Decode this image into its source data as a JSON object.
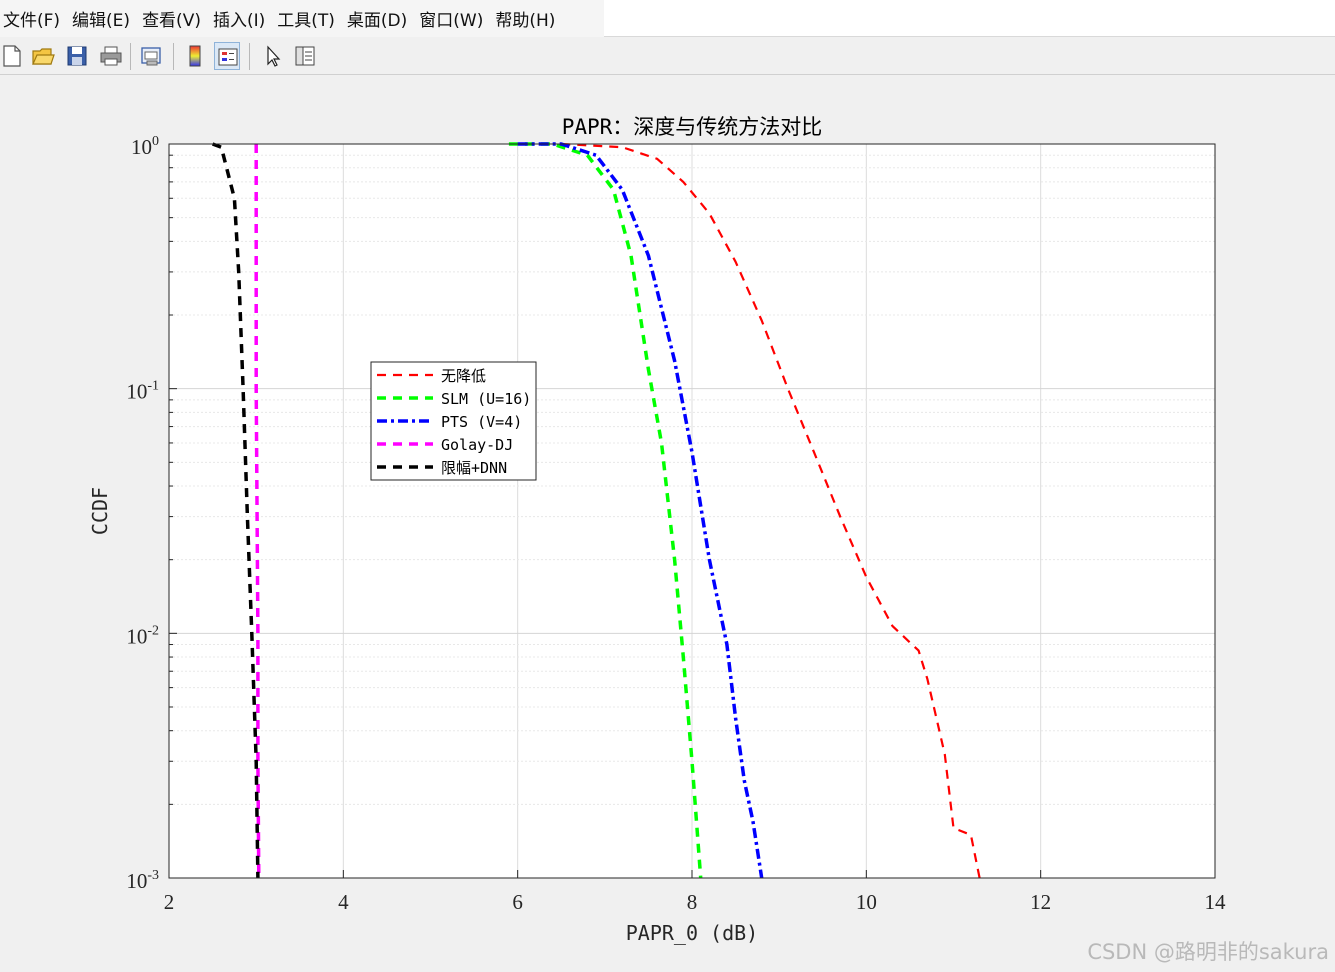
{
  "menu": [
    "文件(F)",
    "编辑(E)",
    "查看(V)",
    "插入(I)",
    "工具(T)",
    "桌面(D)",
    "窗口(W)",
    "帮助(H)"
  ],
  "toolbar": {
    "icons": [
      "new-file-icon",
      "open-folder-icon",
      "save-icon",
      "print-icon",
      "print-preview-icon",
      "colorbar-icon",
      "legend-icon",
      "pointer-icon",
      "property-editor-icon"
    ]
  },
  "watermark": "CSDN @路明非的sakura",
  "chart_data": {
    "type": "line",
    "title": "PAPR：深度与传统方法对比",
    "xlabel": "PAPR_0 (dB)",
    "ylabel": "CCDF",
    "xlim": [
      2,
      14
    ],
    "ylim": [
      0.001,
      1
    ],
    "yscale": "log",
    "xticks": [
      "2",
      "4",
      "6",
      "8",
      "10",
      "12",
      "14"
    ],
    "yticks": [
      {
        "base": "10",
        "exp": "0"
      },
      {
        "base": "10",
        "exp": "-1"
      },
      {
        "base": "10",
        "exp": "-2"
      },
      {
        "base": "10",
        "exp": "-3"
      }
    ],
    "grid": true,
    "legend_position": "inside-left",
    "series": [
      {
        "name": "无降低",
        "color": "#ff0000",
        "style": "dashed",
        "x": [
          6.5,
          7.2,
          7.6,
          7.9,
          8.2,
          8.5,
          8.8,
          9.1,
          9.4,
          9.7,
          10.0,
          10.3,
          10.6,
          10.7,
          10.9,
          11.0,
          11.2,
          11.3
        ],
        "y": [
          1.0,
          0.97,
          0.87,
          0.7,
          0.52,
          0.33,
          0.19,
          0.1,
          0.055,
          0.03,
          0.017,
          0.0107,
          0.0085,
          0.0065,
          0.0032,
          0.0016,
          0.0015,
          0.001
        ]
      },
      {
        "name": "SLM (U=16)",
        "color": "#00ff00",
        "style": "dashed",
        "x": [
          5.9,
          6.4,
          6.8,
          7.1,
          7.3,
          7.5,
          7.65,
          7.8,
          7.9,
          8.0,
          8.1
        ],
        "y": [
          1.0,
          1.0,
          0.9,
          0.65,
          0.35,
          0.12,
          0.06,
          0.02,
          0.008,
          0.003,
          0.001
        ]
      },
      {
        "name": "PTS (V=4)",
        "color": "#0000ff",
        "style": "dashdot",
        "x": [
          6.0,
          6.5,
          6.9,
          7.2,
          7.5,
          7.8,
          8.0,
          8.2,
          8.4,
          8.5,
          8.6,
          8.7,
          8.8
        ],
        "y": [
          1.0,
          1.0,
          0.9,
          0.65,
          0.35,
          0.13,
          0.055,
          0.02,
          0.009,
          0.0045,
          0.0025,
          0.0017,
          0.001
        ]
      },
      {
        "name": "Golay-DJ",
        "color": "#ff00ff",
        "style": "dashed",
        "x": [
          3.0,
          3.0,
          3.02,
          3.02,
          3.03
        ],
        "y": [
          1.0,
          0.1,
          0.01,
          0.003,
          0.001
        ]
      },
      {
        "name": "限幅+DNN",
        "color": "#000000",
        "style": "dashed",
        "x": [
          2.5,
          2.6,
          2.75,
          2.8,
          2.85,
          2.9,
          2.95,
          3.0,
          3.02
        ],
        "y": [
          1.0,
          0.97,
          0.6,
          0.3,
          0.1,
          0.03,
          0.01,
          0.003,
          0.001
        ]
      }
    ]
  }
}
